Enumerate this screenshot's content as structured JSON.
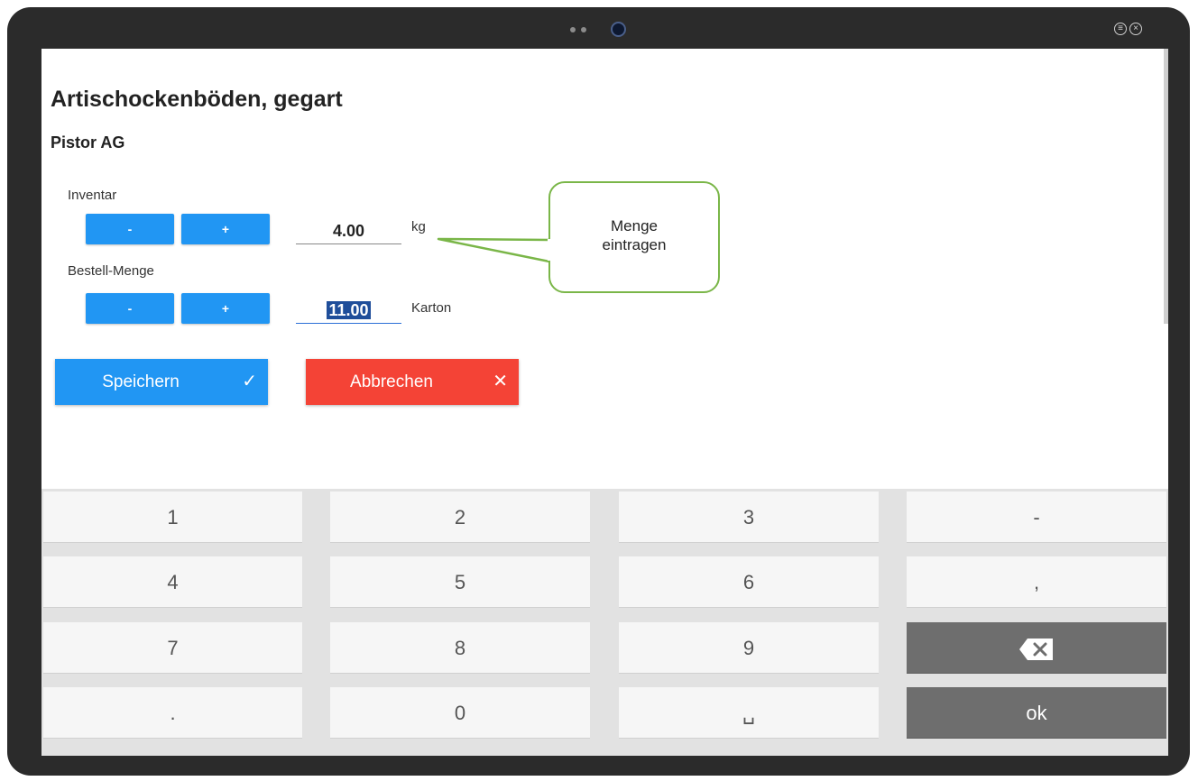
{
  "form": {
    "title": "Artischockenböden, gegart",
    "supplier": "Pistor AG",
    "inventory": {
      "label": "Inventar",
      "minus_label": "-",
      "plus_label": "+",
      "value": "4.00",
      "unit": "kg"
    },
    "order": {
      "label": "Bestell-Menge",
      "minus_label": "-",
      "plus_label": "+",
      "value": "11.00",
      "unit": "Karton"
    },
    "save_label": "Speichern",
    "cancel_label": "Abbrechen"
  },
  "callout": {
    "line1": "Menge",
    "line2": "eintragen"
  },
  "keypad": {
    "keys": [
      "1",
      "2",
      "3",
      "-",
      "4",
      "5",
      "6",
      ",",
      "7",
      "8",
      "9",
      "backspace",
      ".",
      "0",
      "␣",
      "ok"
    ]
  },
  "icons": {
    "save": "check-icon",
    "cancel": "close-icon",
    "backspace": "backspace-icon",
    "window_menu": "menu-icon",
    "window_close": "close-icon"
  },
  "colors": {
    "primary": "#2196f3",
    "danger": "#f44336",
    "callout_border": "#7ab648",
    "dark_key": "#6e6e6e"
  }
}
